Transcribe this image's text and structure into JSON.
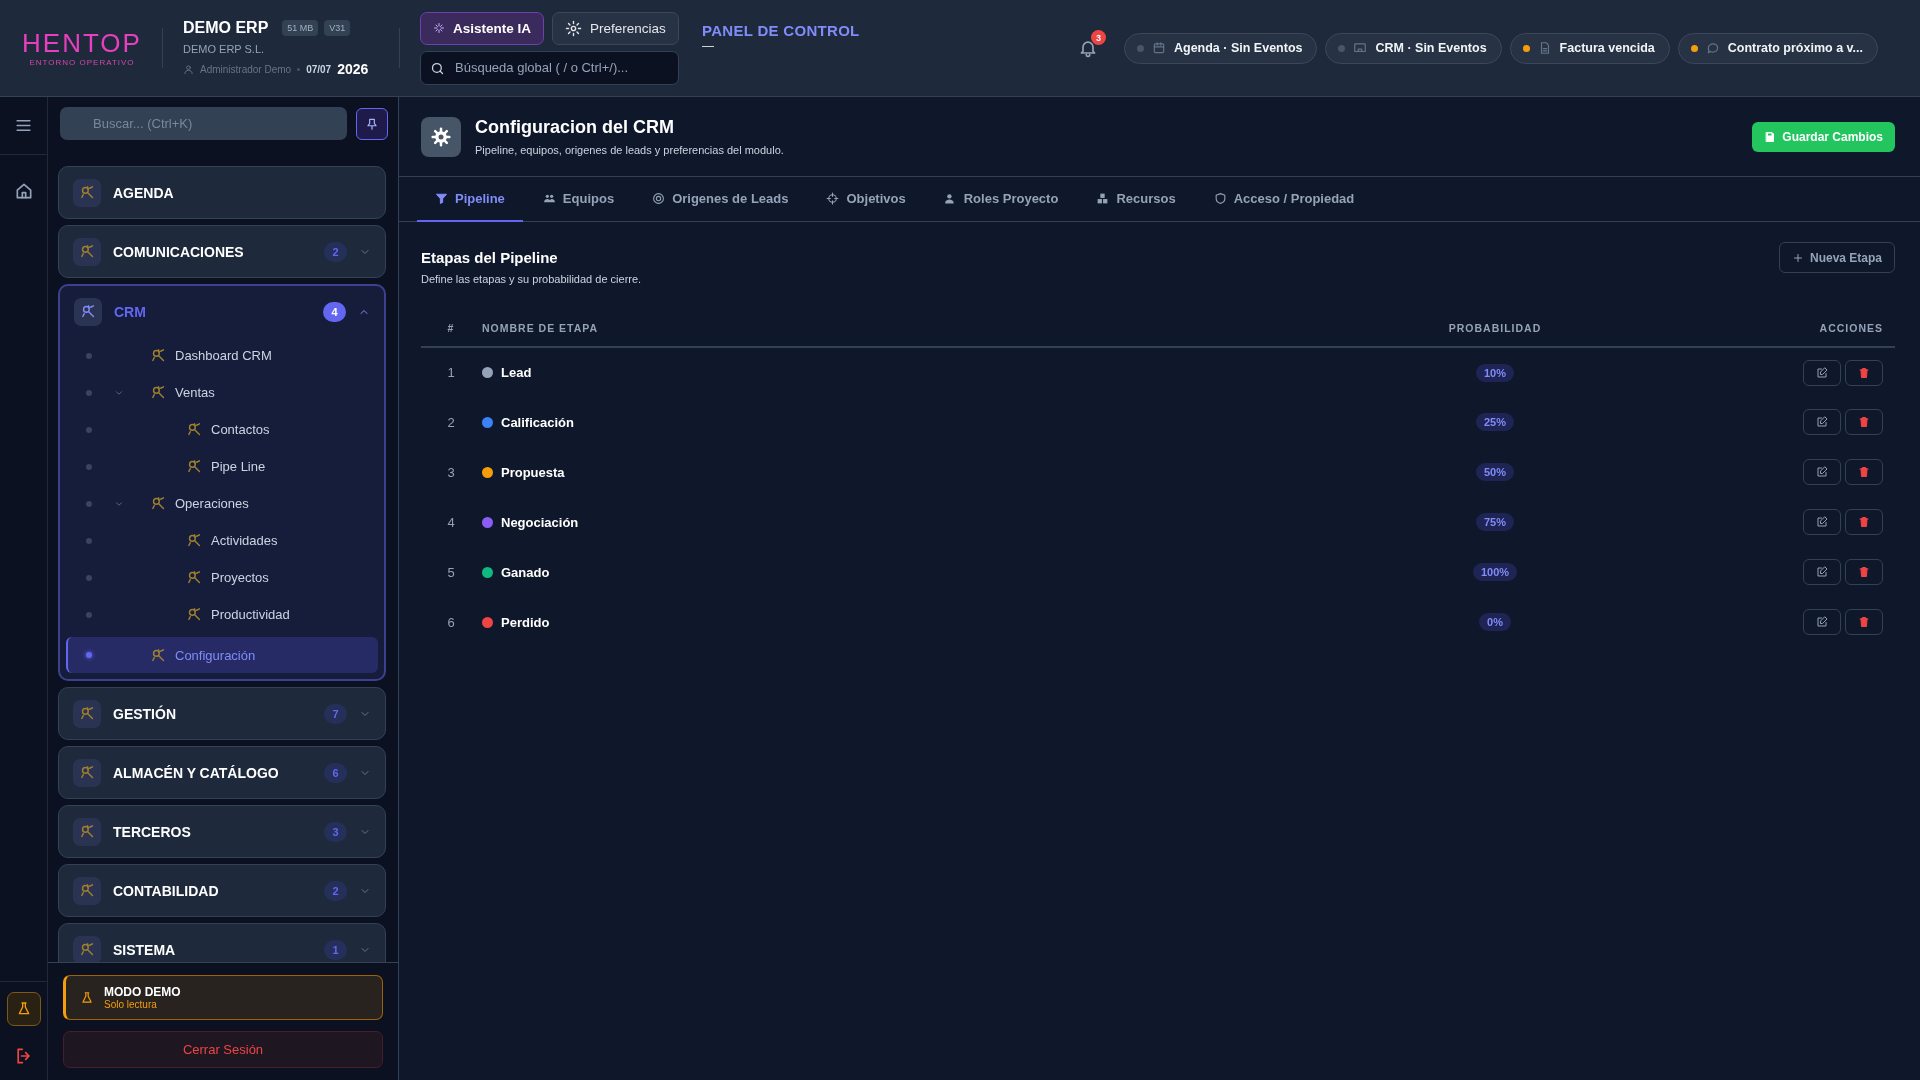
{
  "header": {
    "logo": "HENTOP",
    "tagline": "ENTORNO OPERATIVO",
    "company": "DEMO ERP",
    "badges": [
      "51 MB",
      "V31"
    ],
    "company_legal": "DEMO ERP S.L.",
    "user": "Administrador Demo",
    "date": "07/07",
    "year": "2026",
    "buttons": [
      {
        "label": "Asistente IA",
        "selected": true
      },
      {
        "label": "Preferencias",
        "selected": false
      }
    ],
    "search": {
      "placeholder": "Búsqueda global ( / o Ctrl+/)..."
    },
    "panel_title": "PANEL DE CONTROL",
    "panel_subtitle": "—",
    "notifications": "3",
    "chips": [
      {
        "label": "Agenda · Sin Eventos",
        "color": "#4b5563"
      },
      {
        "label": "CRM · Sin Eventos",
        "color": "#4b5563"
      },
      {
        "label": "Factura vencida",
        "color": "#f59e0b"
      },
      {
        "label": "Contrato próximo a v...",
        "color": "#f59e0b"
      }
    ]
  },
  "sidebar": {
    "search": {
      "placeholder": "Buscar... (Ctrl+K)"
    },
    "sections": [
      {
        "label": "AGENDA",
        "expanded": false
      },
      {
        "label": "COMUNICACIONES",
        "count": "2",
        "expanded": false
      },
      {
        "label": "CRM",
        "count": "4",
        "expanded": true,
        "children": [
          {
            "label": "Dashboard CRM",
            "selected": false
          },
          {
            "label": "Ventas",
            "expanded": true,
            "selected": false,
            "children": [
              {
                "label": "Contactos",
                "selected": false
              },
              {
                "label": "Pipe Line",
                "selected": false
              }
            ]
          },
          {
            "label": "Operaciones",
            "expanded": true,
            "selected": false,
            "children": [
              {
                "label": "Actividades",
                "selected": false
              },
              {
                "label": "Proyectos",
                "selected": false
              },
              {
                "label": "Productividad",
                "selected": false
              }
            ]
          },
          {
            "label": "Configuración",
            "selected": true
          }
        ]
      },
      {
        "label": "GESTIÓN",
        "count": "7",
        "expanded": false
      },
      {
        "label": "ALMACÉN Y CATÁLOGO",
        "count": "6",
        "expanded": false
      },
      {
        "label": "TERCEROS",
        "count": "3",
        "expanded": false
      },
      {
        "label": "CONTABILIDAD",
        "count": "2",
        "expanded": false
      },
      {
        "label": "SISTEMA",
        "count": "1",
        "expanded": false
      }
    ],
    "demo": {
      "title": "MODO DEMO",
      "subtitle": "Solo lectura"
    },
    "logout": "Cerrar Sesión"
  },
  "page": {
    "title": "Configuracion del CRM",
    "subtitle": "Pipeline, equipos, origenes de leads y preferencias del modulo.",
    "save_button": "Guardar Cambios",
    "tabs": [
      {
        "label": "Pipeline",
        "selected": true
      },
      {
        "label": "Equipos",
        "selected": false
      },
      {
        "label": "Origenes de Leads",
        "selected": false
      },
      {
        "label": "Objetivos",
        "selected": false
      },
      {
        "label": "Roles Proyecto",
        "selected": false
      },
      {
        "label": "Recursos",
        "selected": false
      },
      {
        "label": "Acceso / Propiedad",
        "selected": false
      }
    ],
    "section_title": "Etapas del Pipeline",
    "section_subtitle": "Define las etapas y su probabilidad de cierre.",
    "new_button": "Nueva Etapa",
    "table": {
      "columns": [
        "#",
        "NOMBRE DE ETAPA",
        "PROBABILIDAD",
        "ACCIONES"
      ],
      "rows": [
        {
          "number": "1",
          "name": "Lead",
          "color": "#94a3b8",
          "probability": "10%"
        },
        {
          "number": "2",
          "name": "Calificación",
          "color": "#3b82f6",
          "probability": "25%"
        },
        {
          "number": "3",
          "name": "Propuesta",
          "color": "#f59e0b",
          "probability": "50%"
        },
        {
          "number": "4",
          "name": "Negociación",
          "color": "#8b5cf6",
          "probability": "75%"
        },
        {
          "number": "5",
          "name": "Ganado",
          "color": "#10b981",
          "probability": "100%"
        },
        {
          "number": "6",
          "name": "Perdido",
          "color": "#ef4444",
          "probability": "0%"
        }
      ]
    }
  }
}
